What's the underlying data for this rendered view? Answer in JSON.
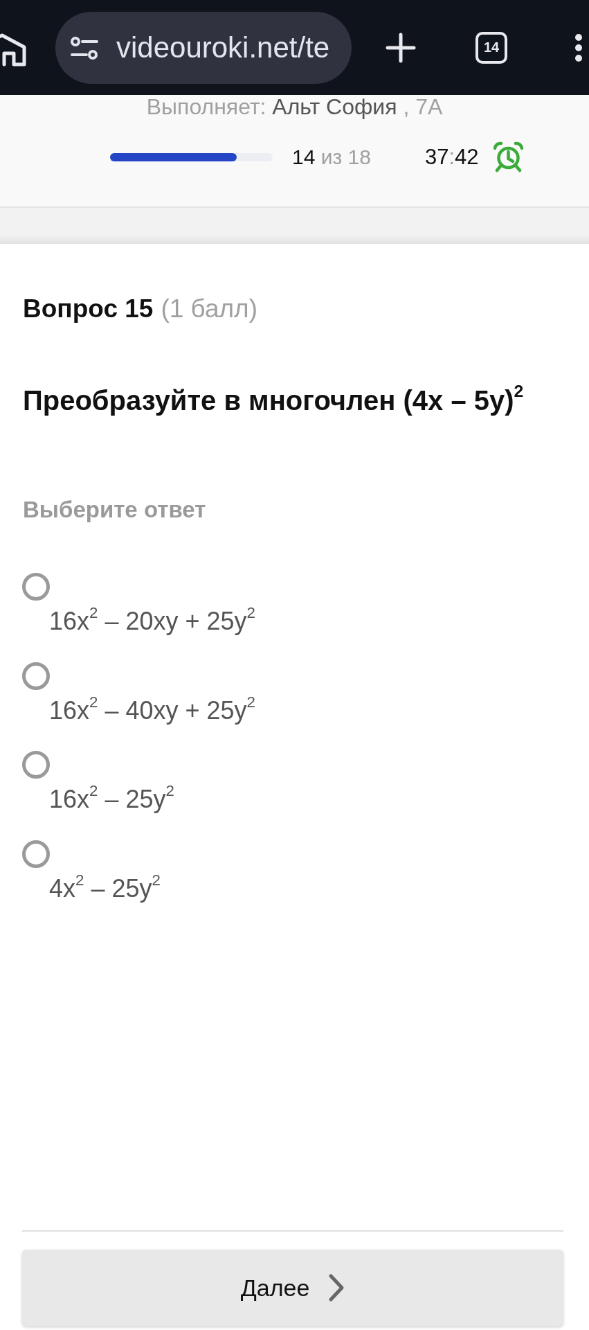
{
  "browser_bar": {
    "url": "videouroki.net/te",
    "tab_count": "14"
  },
  "header": {
    "performer": {
      "label": "Выполняет:",
      "name": "Альт София",
      "group": ", 7А"
    },
    "progress": {
      "level": 0.78,
      "current": "14",
      "total": "из 18"
    },
    "timer": {
      "minutes": "37",
      "separator": ":",
      "seconds": "42"
    }
  },
  "question": {
    "title": "Вопрос 15",
    "points": "(1 балл)",
    "text": "Преобразуйте в многочлен (4x – 5y)$^{2}$",
    "instruction": "Выберите ответ",
    "options": [
      {
        "label": "16x$^{2}$ – 20xy + 25y$^{2}$",
        "selected": false
      },
      {
        "label": "16x$^{2}$ – 40xy + 25y$^{2}$",
        "selected": false
      },
      {
        "label": "16x$^{2}$ – 25y$^{2}$",
        "selected": false
      },
      {
        "label": "4x$^{2}$ – 25y$^{2}$",
        "selected": false
      }
    ]
  },
  "footer": {
    "next_button": "Далее"
  }
}
